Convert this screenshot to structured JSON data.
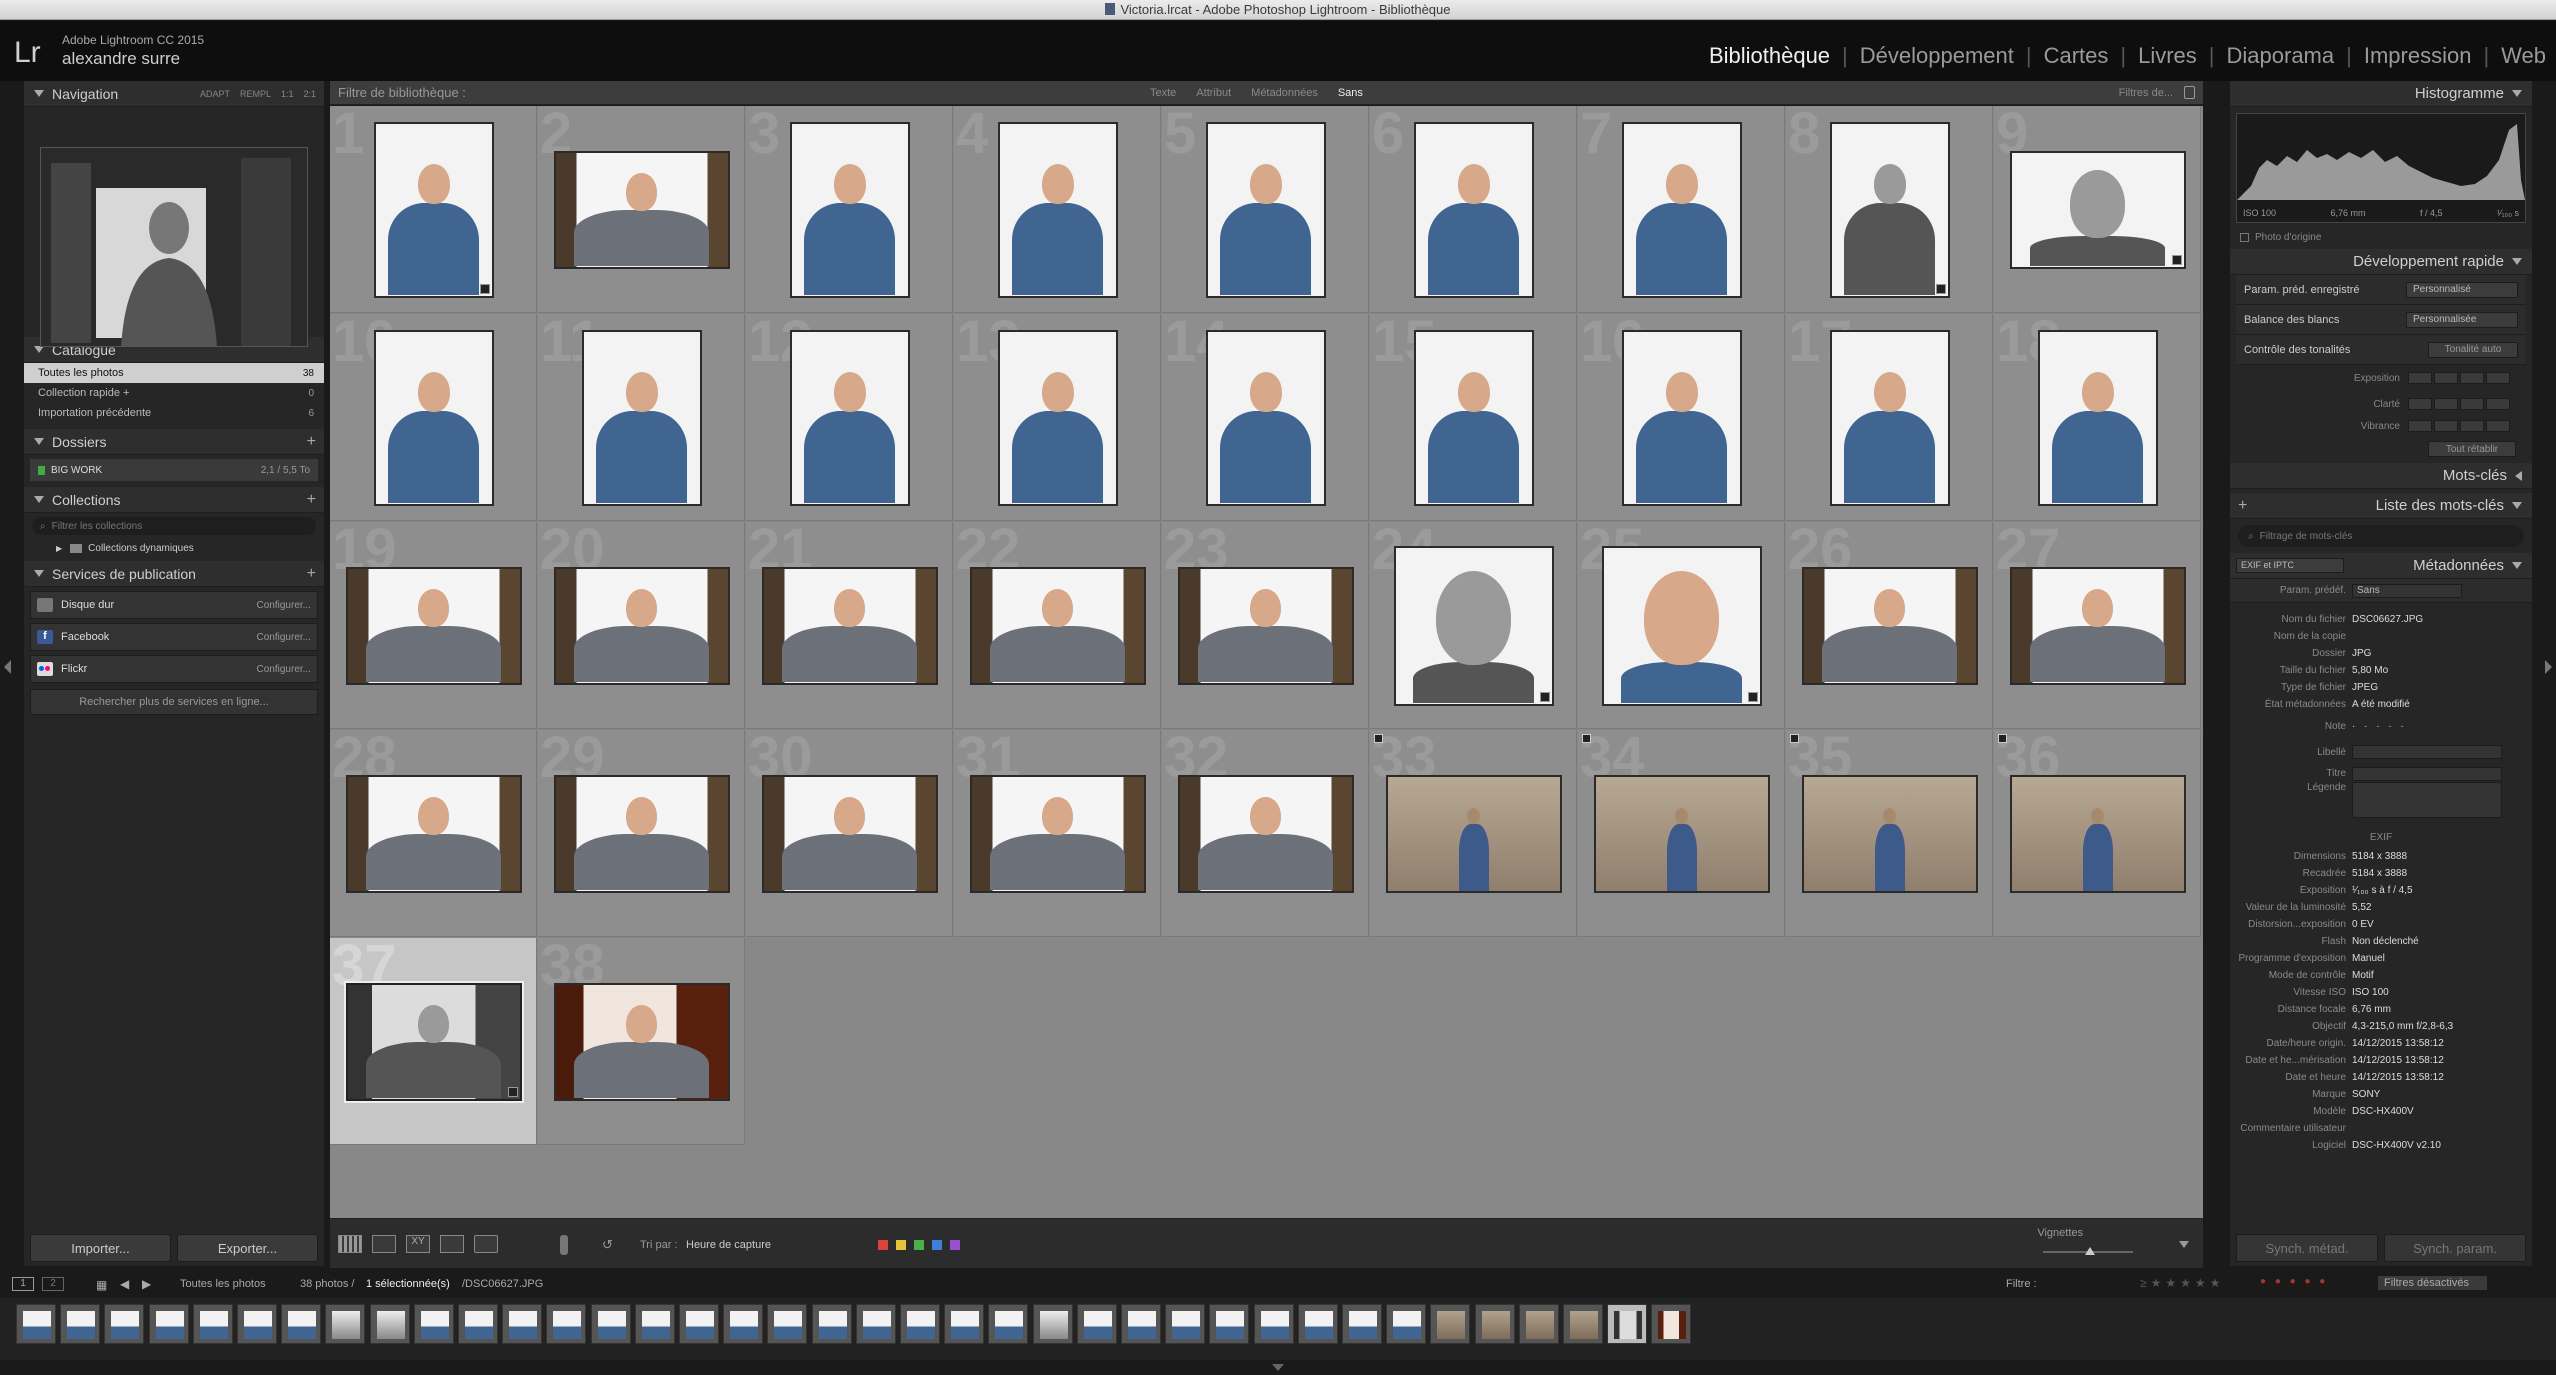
{
  "window": {
    "title": "Victoria.lrcat - Adobe Photoshop Lightroom - Bibliothèque"
  },
  "identity": {
    "logo": "Lr",
    "product": "Adobe Lightroom CC 2015",
    "user": "alexandre surre"
  },
  "modules": [
    "Bibliothèque",
    "Développement",
    "Cartes",
    "Livres",
    "Diaporama",
    "Impression",
    "Web"
  ],
  "left": {
    "navigation": {
      "title": "Navigation",
      "options": [
        "ADAPT",
        "REMPL",
        "1:1",
        "2:1"
      ]
    },
    "catalogue": {
      "title": "Catalogue",
      "items": [
        {
          "label": "Toutes les photos",
          "count": "38"
        },
        {
          "label": "Collection rapide +",
          "count": "0"
        },
        {
          "label": "Importation précédente",
          "count": "6"
        }
      ]
    },
    "dossiers": {
      "title": "Dossiers",
      "volume": "BIG WORK",
      "volume_info": "2,1 / 5,5 To"
    },
    "collections": {
      "title": "Collections",
      "search_placeholder": "Filtrer les collections",
      "item": "Collections dynamiques"
    },
    "publish": {
      "title": "Services de publication",
      "services": [
        {
          "name": "Disque dur",
          "action": "Configurer..."
        },
        {
          "name": "Facebook",
          "action": "Configurer..."
        },
        {
          "name": "Flickr",
          "action": "Configurer..."
        }
      ],
      "more": "Rechercher plus de services en ligne..."
    },
    "import_label": "Importer...",
    "export_label": "Exporter..."
  },
  "filterbar": {
    "label": "Filtre de bibliothèque :",
    "options": [
      "Texte",
      "Attribut",
      "Métadonnées",
      "Sans"
    ],
    "presets": "Filtres de..."
  },
  "grid_numbers": [
    "1",
    "2",
    "3",
    "4",
    "5",
    "6",
    "7",
    "8",
    "9",
    "10",
    "11",
    "12",
    "13",
    "14",
    "15",
    "16",
    "17",
    "18",
    "19",
    "20",
    "21",
    "22",
    "23",
    "24",
    "25",
    "26",
    "27",
    "28",
    "29",
    "30",
    "31",
    "32",
    "33",
    "34",
    "35",
    "36",
    "37",
    "38"
  ],
  "toolbar": {
    "sort_label": "Tri par :",
    "sort_value": "Heure de capture",
    "thumbs_label": "Vignettes"
  },
  "right": {
    "histogram": {
      "title": "Histogramme",
      "iso": "ISO 100",
      "focal": "6,76 mm",
      "aperture": "f / 4,5",
      "shutter": "¹⁄₁₀₀ s",
      "original": "Photo d'origine"
    },
    "quick_develop": {
      "title": "Développement rapide",
      "preset_label": "Param. préd. enregistré",
      "preset_value": "Personnalisé",
      "wb_label": "Balance des blancs",
      "wb_value": "Personnalisée",
      "tone_label": "Contrôle des tonalités",
      "tone_auto": "Tonalité auto",
      "exposure": "Exposition",
      "clarity": "Clarté",
      "vibrance": "Vibrance",
      "reset": "Tout rétablir"
    },
    "keywording": {
      "title": "Mots-clés"
    },
    "keyword_list": {
      "title": "Liste des mots-clés",
      "search_placeholder": "Filtrage de mots-clés"
    },
    "metadata": {
      "title": "Métadonnées",
      "mode": "EXIF et IPTC",
      "preset_label": "Param. prédéf.",
      "preset_value": "Sans",
      "file_rows": [
        {
          "k": "Nom du fichier",
          "v": "DSC06627.JPG"
        },
        {
          "k": "Nom de la copie",
          "v": ""
        },
        {
          "k": "Dossier",
          "v": "JPG"
        },
        {
          "k": "Taille du fichier",
          "v": "5,80 Mo"
        },
        {
          "k": "Type de fichier",
          "v": "JPEG"
        },
        {
          "k": "État métadonnées",
          "v": "A été modifié"
        }
      ],
      "note_label": "Note",
      "note_value": "· · · · ·",
      "label_label": "Libellé",
      "title_label": "Titre",
      "caption_label": "Légende",
      "exif_header": "EXIF",
      "exif_rows": [
        {
          "k": "Dimensions",
          "v": "5184 x 3888"
        },
        {
          "k": "Recadrée",
          "v": "5184 x 3888"
        },
        {
          "k": "Exposition",
          "v": "¹⁄₁₀₀ s à f / 4,5"
        },
        {
          "k": "Valeur de la luminosité",
          "v": "5,52"
        },
        {
          "k": "Distorsion...exposition",
          "v": "0 EV"
        },
        {
          "k": "Flash",
          "v": "Non déclenché"
        },
        {
          "k": "Programme d'exposition",
          "v": "Manuel"
        },
        {
          "k": "Mode de contrôle",
          "v": "Motif"
        },
        {
          "k": "Vitesse ISO",
          "v": "ISO 100"
        },
        {
          "k": "Distance focale",
          "v": "6,76 mm"
        },
        {
          "k": "Objectif",
          "v": "4,3-215,0 mm f/2,8-6,3"
        },
        {
          "k": "Date/heure origin.",
          "v": "14/12/2015 13:58:12"
        },
        {
          "k": "Date et he...mérisation",
          "v": "14/12/2015 13:58:12"
        },
        {
          "k": "Date et heure",
          "v": "14/12/2015 13:58:12"
        },
        {
          "k": "Marque",
          "v": "SONY"
        },
        {
          "k": "Modèle",
          "v": "DSC-HX400V"
        },
        {
          "k": "Commentaire utilisateur",
          "v": ""
        },
        {
          "k": "Logiciel",
          "v": "DSC-HX400V v2.10"
        }
      ]
    },
    "sync_meta": "Synch. métad.",
    "sync_settings": "Synch. param."
  },
  "filmstrip": {
    "source": "Toutes les photos",
    "count_text": "38 photos /",
    "selected_text": "1 sélectionnée(s)",
    "file_text": "/DSC06627.JPG",
    "filter_label": "Filtre :",
    "filter_state": "Filtres désactivés"
  },
  "colors": {
    "accent_red": "#d9453b",
    "accent_yellow": "#e5c43a",
    "accent_green": "#4ab04a",
    "accent_blue": "#3f7fd9",
    "accent_purple": "#9a4fd0"
  }
}
